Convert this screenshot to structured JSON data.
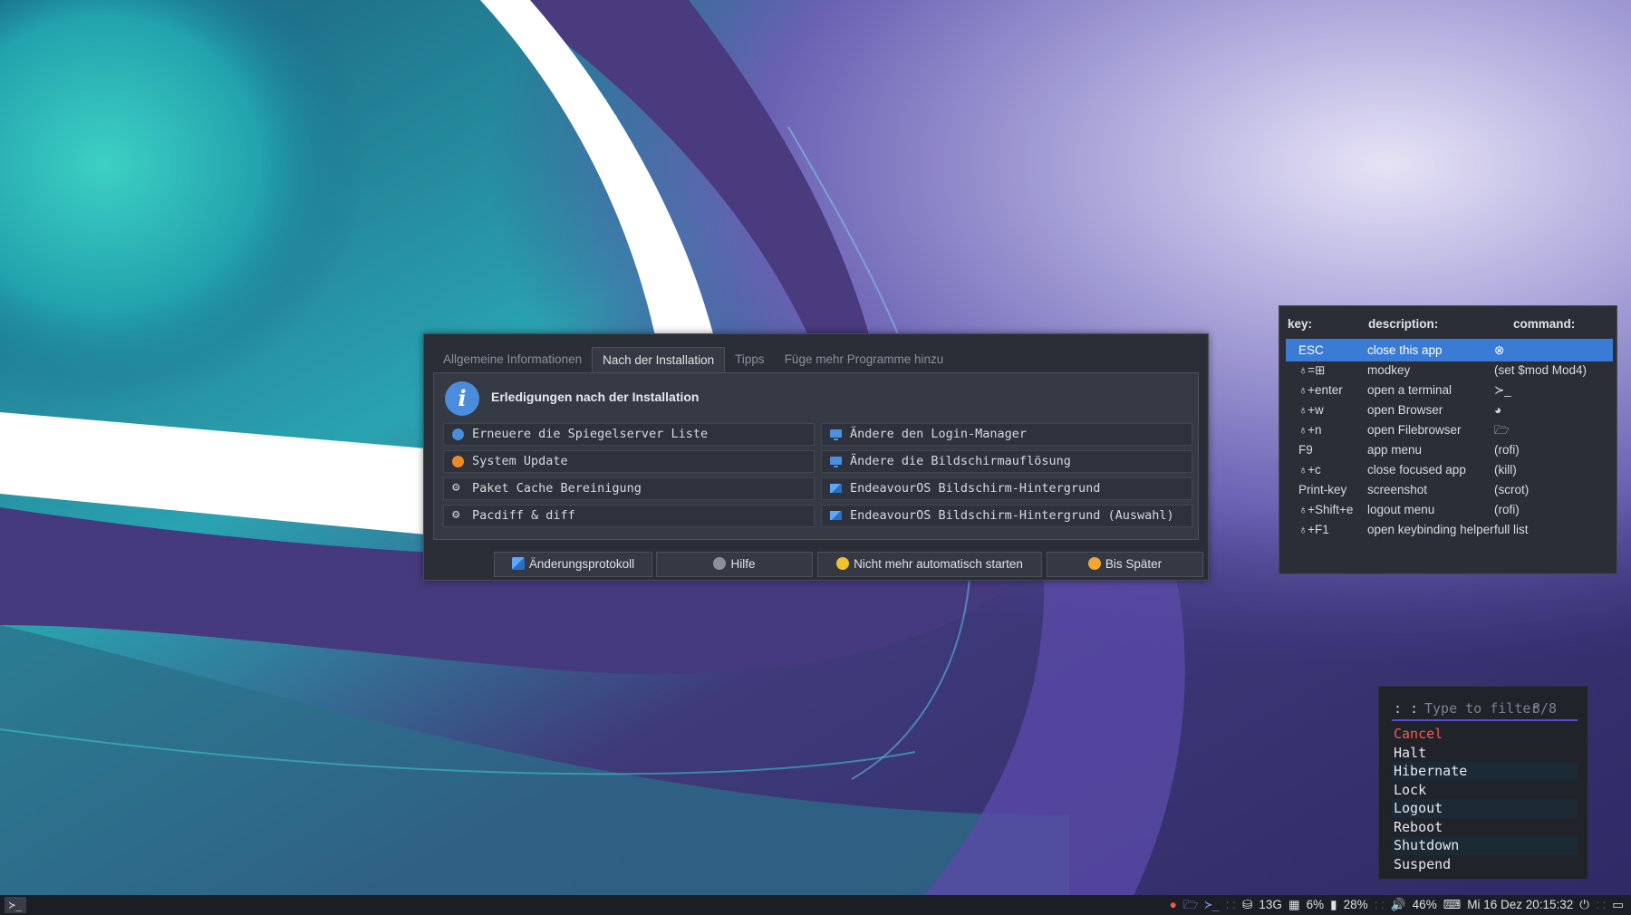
{
  "colors": {
    "selection": "#3a7bd5",
    "rofi_active": "#f05a4f",
    "rofi_underline": "#5a4bd1",
    "info_blue": "#4a8ddc"
  },
  "welcome": {
    "tabs": [
      "Allgemeine Informationen",
      "Nach der Installation",
      "Tipps",
      "Füge mehr Programme hinzu"
    ],
    "active_tab": "Nach der Installation",
    "heading": "Erledigungen nach der Installation",
    "left_actions": [
      {
        "label": "Erneuere die Spiegelserver Liste",
        "icon": "globe-icon"
      },
      {
        "label": "System Update",
        "icon": "update-icon"
      },
      {
        "label": "Paket Cache Bereinigung",
        "icon": "gear-icon"
      },
      {
        "label": "Pacdiff & diff",
        "icon": "gear-icon"
      }
    ],
    "right_actions": [
      {
        "label": "Ändere den Login-Manager",
        "icon": "monitor-icon"
      },
      {
        "label": "Ändere die Bildschirmauflösung",
        "icon": "monitor-icon"
      },
      {
        "label": "EndeavourOS Bildschirm-Hintergrund",
        "icon": "wallpaper-icon"
      },
      {
        "label": "EndeavourOS Bildschirm-Hintergrund (Auswahl)",
        "icon": "wallpaper-icon"
      }
    ],
    "footer": {
      "changelog": "Änderungsprotokoll",
      "help": "Hilfe",
      "no_autostart": "Nicht mehr automatisch starten",
      "later": "Bis Später"
    }
  },
  "keyhelp": {
    "headers": [
      "key:",
      "description:",
      "command:"
    ],
    "rows": [
      {
        "key": "ESC",
        "desc": "close this app",
        "cmd": "⊗"
      },
      {
        "key": "♁=⊞",
        "desc": "modkey",
        "cmd": "(set $mod Mod4)"
      },
      {
        "key": "♁+enter",
        "desc": "open a terminal",
        "cmd": "≻_"
      },
      {
        "key": "♁+w",
        "desc": "open Browser",
        "cmd": "◕"
      },
      {
        "key": "♁+n",
        "desc": "open Filebrowser",
        "cmd": "🗁"
      },
      {
        "key": "F9",
        "desc": "app menu",
        "cmd": "(rofi)"
      },
      {
        "key": "♁+c",
        "desc": "close focused app",
        "cmd": "(kill)"
      },
      {
        "key": "Print-key",
        "desc": "screenshot",
        "cmd": "(scrot)"
      },
      {
        "key": "♁+Shift+e",
        "desc": "logout menu",
        "cmd": "(rofi)"
      },
      {
        "key": "♁+F1",
        "desc": "open keybinding helper",
        "cmd": "full list"
      }
    ]
  },
  "rofi": {
    "prompt": ": :",
    "placeholder": "Type to filter",
    "count": "8/8",
    "items": [
      "Cancel",
      "Halt",
      "Hibernate",
      "Lock",
      "Logout",
      "Reboot",
      "Shutdown",
      "Suspend"
    ]
  },
  "panel": {
    "terminal_glyph": "≻_",
    "disk": "13G",
    "cpu": "6%",
    "memory": "28%",
    "volume": "46%",
    "clock": "Mi 16 Dez 20:15:32"
  }
}
